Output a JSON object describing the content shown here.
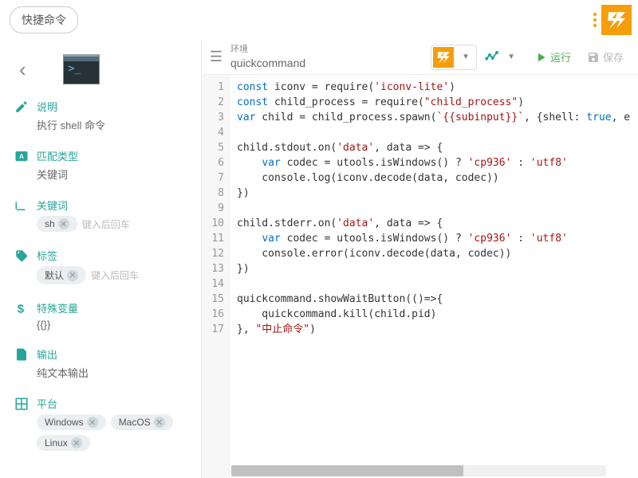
{
  "title": "快捷命令",
  "sidebar": {
    "desc": {
      "title": "说明",
      "value": "执行 shell 命令"
    },
    "matchType": {
      "title": "匹配类型",
      "value": "关键词"
    },
    "keywords": {
      "title": "关键词",
      "tag": "sh",
      "hint": "键入后回车"
    },
    "labels": {
      "title": "标签",
      "tag": "默认",
      "hint": "键入后回车"
    },
    "vars": {
      "title": "特殊变量",
      "value": "{{}}"
    },
    "output": {
      "title": "输出",
      "value": "纯文本输出"
    },
    "platform": {
      "title": "平台",
      "items": [
        "Windows",
        "MacOS",
        "Linux"
      ]
    }
  },
  "toolbar": {
    "envLabel": "环境",
    "envName": "quickcommand",
    "run": "运行",
    "save": "保存"
  },
  "code": {
    "lines": [
      [
        [
          "kw",
          "const"
        ],
        [
          "",
          " iconv = require("
        ],
        [
          "str",
          "'iconv-lite'"
        ],
        [
          "",
          ")"
        ]
      ],
      [
        [
          "kw",
          "const"
        ],
        [
          "",
          " child_process = require("
        ],
        [
          "str",
          "\"child_process\""
        ],
        [
          "",
          ")"
        ]
      ],
      [
        [
          "kw",
          "var"
        ],
        [
          "",
          " child = child_process.spawn("
        ],
        [
          "tmpl",
          "`{{subinput}}`"
        ],
        [
          "",
          ", {shell: "
        ],
        [
          "kw",
          "true"
        ],
        [
          "",
          ", e"
        ]
      ],
      [
        [
          "",
          ""
        ]
      ],
      [
        [
          "",
          "child.stdout.on("
        ],
        [
          "str",
          "'data'"
        ],
        [
          "",
          ", data => {"
        ]
      ],
      [
        [
          "",
          "    "
        ],
        [
          "kw",
          "var"
        ],
        [
          "",
          " codec = utools.isWindows() ? "
        ],
        [
          "str",
          "'cp936'"
        ],
        [
          "",
          " : "
        ],
        [
          "str",
          "'utf8'"
        ]
      ],
      [
        [
          "",
          "    console.log(iconv.decode(data, codec))"
        ]
      ],
      [
        [
          "",
          "})"
        ]
      ],
      [
        [
          "",
          ""
        ]
      ],
      [
        [
          "",
          "child.stderr.on("
        ],
        [
          "str",
          "'data'"
        ],
        [
          "",
          ", data => {"
        ]
      ],
      [
        [
          "",
          "    "
        ],
        [
          "kw",
          "var"
        ],
        [
          "",
          " codec = utools.isWindows() ? "
        ],
        [
          "str",
          "'cp936'"
        ],
        [
          "",
          " : "
        ],
        [
          "str",
          "'utf8'"
        ]
      ],
      [
        [
          "",
          "    console.error(iconv.decode(data, codec))"
        ]
      ],
      [
        [
          "",
          "})"
        ]
      ],
      [
        [
          "",
          ""
        ]
      ],
      [
        [
          "",
          "quickcommand.showWaitButton(()=>{"
        ]
      ],
      [
        [
          "",
          "    quickcommand.kill(child.pid)"
        ]
      ],
      [
        [
          "",
          "}, "
        ],
        [
          "str",
          "\"中止命令\""
        ],
        [
          "",
          ")"
        ]
      ]
    ]
  }
}
